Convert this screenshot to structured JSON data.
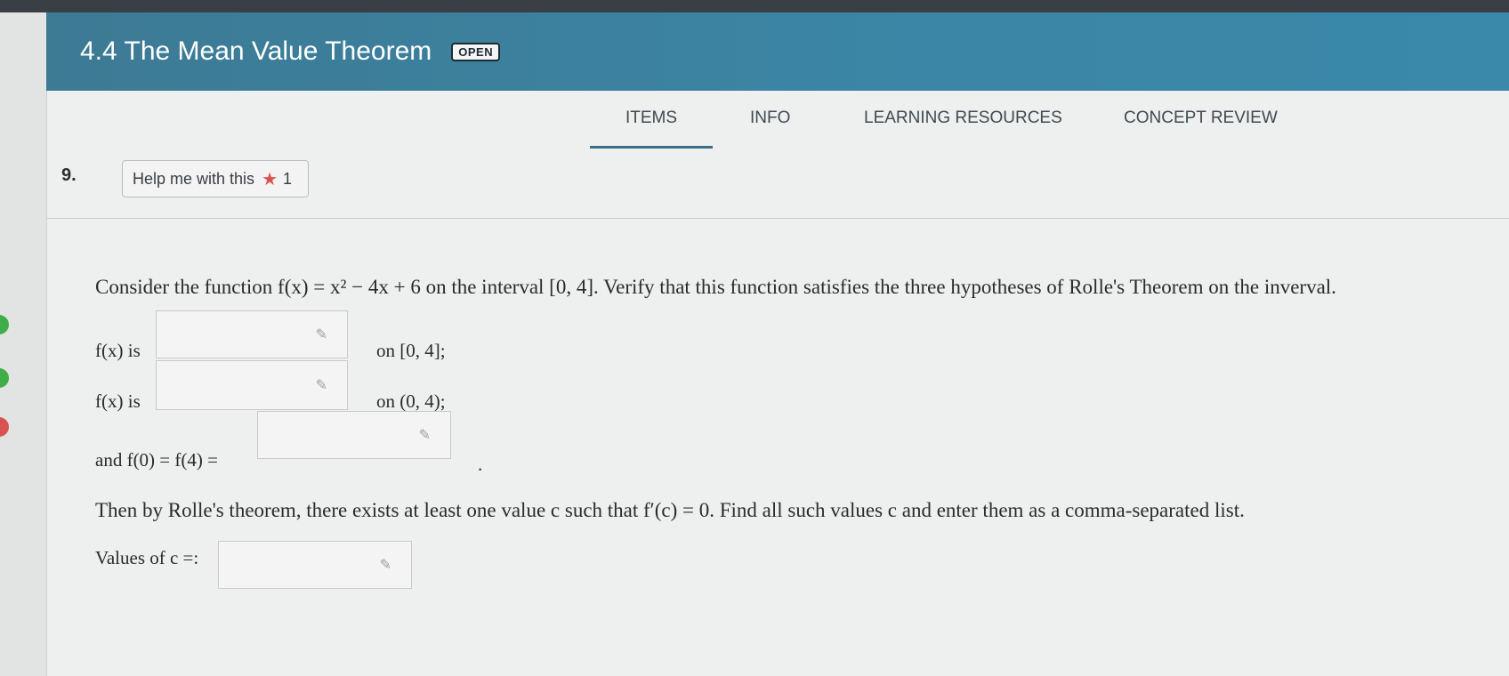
{
  "header": {
    "title": "4.4 The Mean Value Theorem",
    "badge": "OPEN"
  },
  "tabs": [
    {
      "label": "ITEMS",
      "active": true
    },
    {
      "label": "INFO",
      "active": false
    },
    {
      "label": "LEARNING RESOURCES",
      "active": false
    },
    {
      "label": "CONCEPT REVIEW",
      "active": false
    }
  ],
  "question": {
    "number": "9.",
    "help_button": {
      "label": "Help me with this",
      "star_count": "1"
    },
    "statement": "Consider the function f(x) = x² − 4x + 6 on the interval [0, 4]. Verify that this function satisfies the three hypotheses of Rolle's Theorem on the inverval.",
    "row1": {
      "label": "f(x) is",
      "suffix": "on [0, 4];",
      "value": ""
    },
    "row2": {
      "label": "f(x) is",
      "suffix": "on (0, 4);",
      "value": ""
    },
    "row3": {
      "label": "and f(0) = f(4) =",
      "suffix": ".",
      "value": ""
    },
    "rolle_text": "Then by Rolle's theorem, there exists at least one value c such that f′(c) = 0. Find all such values c and enter them as a comma-separated list.",
    "values_label": "Values of c =:",
    "values_answer": ""
  },
  "icons": {
    "pencil": "pencil-icon",
    "star": "star-icon"
  },
  "colors": {
    "header_bg": "#3b86a6",
    "star": "#d9534f",
    "status_green": "#3fae49",
    "status_red": "#d9534f"
  }
}
